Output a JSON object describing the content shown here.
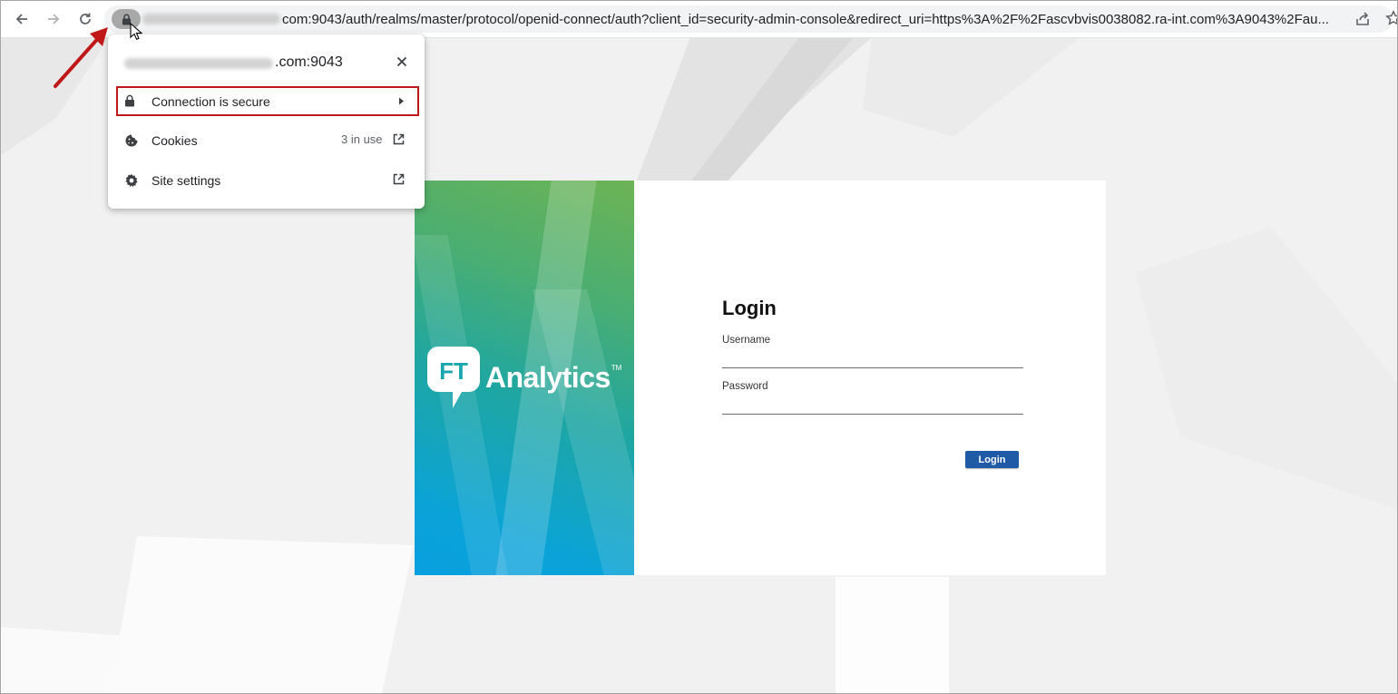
{
  "browser": {
    "url_text": "com:9043/auth/realms/master/protocol/openid-connect/auth?client_id=security-admin-console&redirect_uri=https%3A%2F%2Fascvbvis0038082.ra-int.com%3A9043%2Fau...",
    "icons": {
      "back": "arrow-left-icon",
      "forward": "arrow-right-icon",
      "reload": "reload-icon",
      "lock": "lock-icon",
      "share": "share-icon",
      "bookmark": "star-icon"
    }
  },
  "site_info_popup": {
    "host_suffix": ".com:9043",
    "items": [
      {
        "label": "Connection is secure",
        "icon": "lock-icon",
        "tail_icon": "chevron-right-icon"
      },
      {
        "label": "Cookies",
        "meta": "3 in use",
        "icon": "cookie-icon",
        "tail_icon": "external-link-icon"
      },
      {
        "label": "Site settings",
        "icon": "gear-icon",
        "tail_icon": "external-link-icon"
      }
    ]
  },
  "login": {
    "title": "Login",
    "username_label": "Username",
    "username_value": "",
    "password_label": "Password",
    "password_value": "",
    "button_label": "Login"
  },
  "brand": {
    "badge_text": "FT",
    "word": "Analytics",
    "trademark": "TM"
  },
  "colors": {
    "annotation_red": "#c01818",
    "login_button": "#1f5aa6",
    "brand_green": "#6db354",
    "brand_blue": "#089fdf"
  }
}
